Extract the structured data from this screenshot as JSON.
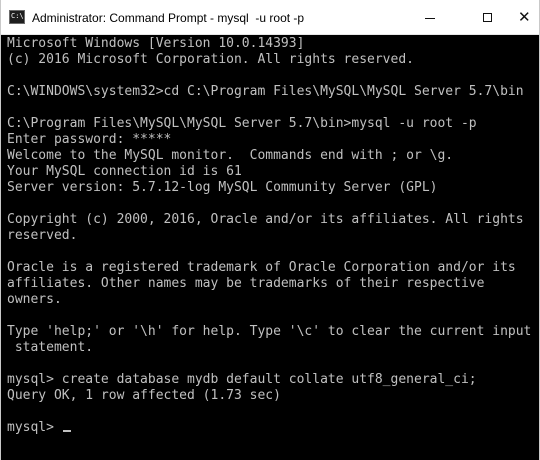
{
  "window": {
    "title": "Administrator: Command Prompt - mysql  -u root -p",
    "app_icon_glyph": "C:\\",
    "close_glyph": "✕"
  },
  "icons": {
    "app": "command-prompt-icon",
    "minimize": "minimize-icon",
    "maximize": "maximize-icon",
    "close": "close-icon"
  },
  "colors": {
    "console_background": "#000000",
    "console_text": "#c0c0c0",
    "titlebar_background": "#ffffff"
  },
  "console": {
    "lines": [
      "Microsoft Windows [Version 10.0.14393]",
      "(c) 2016 Microsoft Corporation. All rights reserved.",
      "",
      "C:\\WINDOWS\\system32>cd C:\\Program Files\\MySQL\\MySQL Server 5.7\\bin",
      "",
      "C:\\Program Files\\MySQL\\MySQL Server 5.7\\bin>mysql -u root -p",
      "Enter password: *****",
      "Welcome to the MySQL monitor.  Commands end with ; or \\g.",
      "Your MySQL connection id is 61",
      "Server version: 5.7.12-log MySQL Community Server (GPL)",
      "",
      "Copyright (c) 2000, 2016, Oracle and/or its affiliates. All rights",
      "reserved.",
      "",
      "Oracle is a registered trademark of Oracle Corporation and/or its",
      "affiliates. Other names may be trademarks of their respective",
      "owners.",
      "",
      "Type 'help;' or '\\h' for help. Type '\\c' to clear the current input",
      " statement.",
      "",
      "mysql> create database mydb default collate utf8_general_ci;",
      "Query OK, 1 row affected (1.73 sec)",
      "",
      "mysql> "
    ]
  }
}
